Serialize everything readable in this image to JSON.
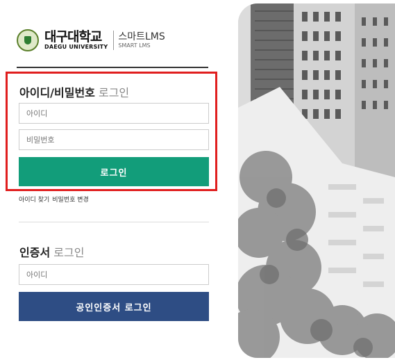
{
  "header": {
    "university_name_ko": "대구대학교",
    "university_name_en": "DAEGU UNIVERSITY",
    "lms_name_ko": "스마트LMS",
    "lms_name_en": "SMART LMS"
  },
  "login": {
    "title_bold": "아이디/비밀번호",
    "title_suffix": "로그인",
    "id_placeholder": "아이디",
    "pw_placeholder": "비밀번호",
    "submit_label": "로그인",
    "find_id_link": "아이디 찾기",
    "change_pw_link": "비밀번호 변경"
  },
  "cert_login": {
    "title_bold": "인증서",
    "title_suffix": "로그인",
    "id_placeholder": "아이디",
    "submit_label": "공인인증서 로그인"
  },
  "colors": {
    "green_button": "#129d7a",
    "navy_button": "#2e4d84",
    "highlight_border": "#e01e1e"
  }
}
